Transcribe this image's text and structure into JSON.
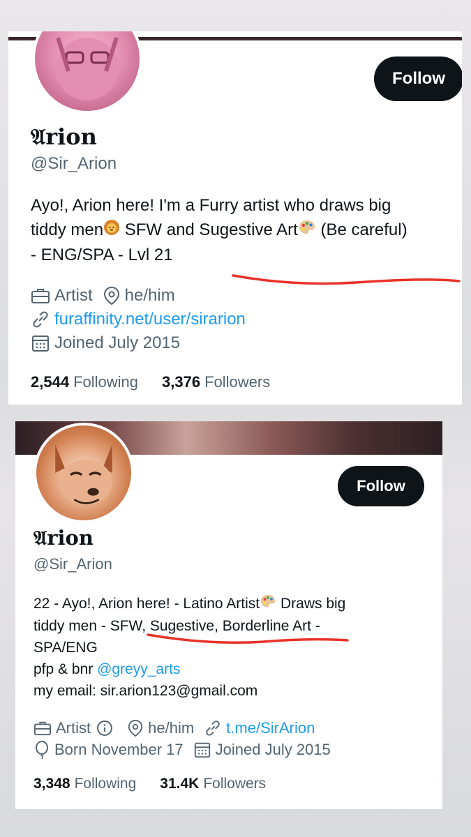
{
  "profile_old": {
    "follow_label": "Follow",
    "name": "𝔄rion",
    "handle": "@Sir_Arion",
    "bio": {
      "line1": "Ayo!, Arion here! I'm a Furry artist who draws big",
      "line2_a": "tiddy men",
      "line2_b": " SFW and Sugestive Art",
      "line2_c": " (Be careful)",
      "line3": "- ENG/SPA - Lvl 21"
    },
    "category": "Artist",
    "location": "he/him",
    "website": "furaffinity.net/user/sirarion",
    "joined": "Joined July 2015",
    "following_count": "2,544",
    "following_label": "Following",
    "followers_count": "3,376",
    "followers_label": "Followers"
  },
  "profile_new": {
    "follow_label": "Follow",
    "name": "𝔄rion",
    "handle": "@Sir_Arion",
    "bio": {
      "line1_a": "22 - Ayo!, Arion here! - Latino Artist",
      "line1_b": " Draws big",
      "line2": "tiddy men - SFW, Sugestive, Borderline Art -",
      "line3": "SPA/ENG",
      "line4_a": "pfp & bnr ",
      "line4_link": "@greyy_arts",
      "line5": "my email: sir.arion123@gmail.com"
    },
    "category": "Artist",
    "location": "he/him",
    "website": "t.me/SirArion",
    "birthday": "Born November 17",
    "joined": "Joined July 2015",
    "following_count": "3,348",
    "following_label": "Following",
    "followers_count": "31.4K",
    "followers_label": "Followers"
  },
  "colors": {
    "link": "#1d9bf0",
    "secondary_text": "#536471",
    "button_bg": "#0f1419",
    "annotation_red": "#e8322a"
  },
  "icons": [
    "briefcase-icon",
    "location-pin-icon",
    "link-icon",
    "calendar-icon",
    "info-icon",
    "balloon-icon",
    "lion-emoji-icon",
    "palette-emoji-icon"
  ]
}
